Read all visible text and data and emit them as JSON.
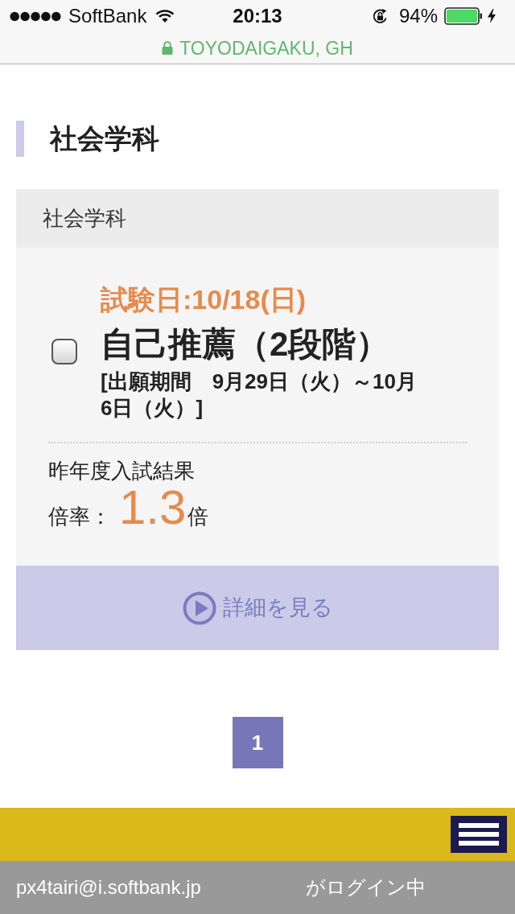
{
  "status_bar": {
    "carrier": "SoftBank",
    "time": "20:13",
    "rotation_lock": true,
    "battery": "94%",
    "charging": true
  },
  "address_bar": {
    "url": "TOYODAIGAKU, GH",
    "secure": true
  },
  "heading": "社会学科",
  "card": {
    "header": "社会学科",
    "entries": [
      {
        "checked": false,
        "exam_date": "試験日:10/18(日)",
        "title": "自己推薦（2段階）",
        "period": "[出願期間　9月29日（火）～10月6日（火）]",
        "result_label": "昨年度入試結果",
        "ratio_label": "倍率：",
        "ratio_value": "1.3",
        "ratio_unit": "倍"
      }
    ],
    "detail_button": "詳細を見る"
  },
  "pagination": [
    {
      "label": "1",
      "selected": true
    }
  ],
  "login_bar": {
    "user": "px4tairi@i.softbank.jp",
    "status": "がログイン中"
  }
}
